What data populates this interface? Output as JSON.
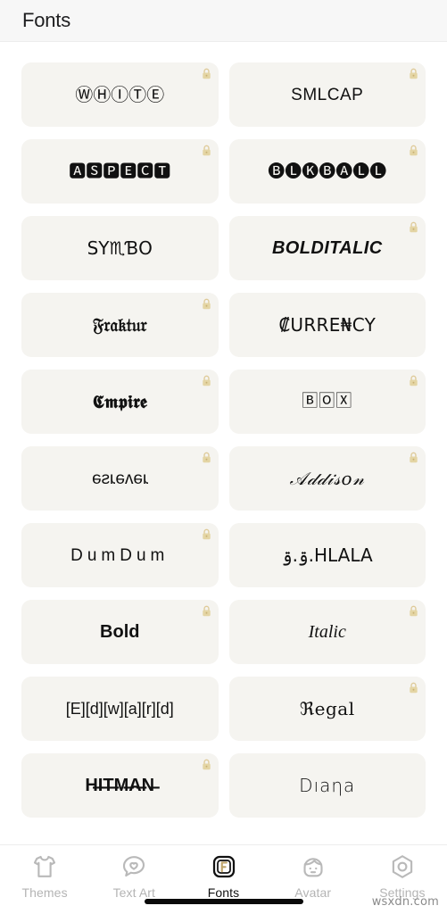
{
  "header": {
    "title": "Fonts"
  },
  "theme": {
    "page_bg": "#ffffff",
    "header_bg": "#f7f7f7",
    "card_bg": "#f5f4f0",
    "text": "#111111",
    "lock_color": "#e3d3a0",
    "tab_inactive": "#b4b4b4",
    "tab_active": "#111111",
    "accent": "#c9b075"
  },
  "fonts_grid": {
    "cards": [
      {
        "id": "white",
        "sample": "ⓌⒽⒾⓉⒺ",
        "style": "s-circled",
        "locked": true
      },
      {
        "id": "smlcap",
        "sample": "SMLCAP",
        "style": "s-plain",
        "locked": true
      },
      {
        "id": "aspect",
        "sample": "🅰🆂🅿🅴🅲🆃",
        "style": "s-blocky",
        "locked": true
      },
      {
        "id": "blkball",
        "sample": "🅑🅛🅚🅑🅐🅛🅛",
        "style": "s-blocky",
        "locked": true
      },
      {
        "id": "symbo",
        "sample": "SY♏ƁO",
        "style": "s-symbol",
        "locked": false
      },
      {
        "id": "bolditalic",
        "sample": "BOLDITALIC",
        "style": "s-bolditalic",
        "locked": true
      },
      {
        "id": "fraktur",
        "sample": "𝔉𝔯𝔞𝔨𝔱𝔲𝔯",
        "style": "s-fraktur",
        "locked": true
      },
      {
        "id": "currency",
        "sample": "₡URRE₦CY",
        "style": "s-currency",
        "locked": false
      },
      {
        "id": "empire",
        "sample": "𝕮𝖒𝖕𝖎𝖗𝖊",
        "style": "s-fraktur",
        "locked": true
      },
      {
        "id": "box",
        "sample": "🄱🄾🅇",
        "style": "s-boxed",
        "locked": true
      },
      {
        "id": "reverse",
        "sample": "ɹǝʌǝɹsǝ",
        "style": "s-reverse",
        "locked": true
      },
      {
        "id": "addison",
        "sample": "𝒜𝒹𝒹𝒾𝓈𝑜𝓃",
        "style": "s-script",
        "locked": true
      },
      {
        "id": "dumdum",
        "sample": "DumDum",
        "style": "s-spaced",
        "locked": true
      },
      {
        "id": "hlala",
        "sample": "ۊ.ۊ.HLALA",
        "style": "s-arabic",
        "locked": false
      },
      {
        "id": "bold",
        "sample": "Bold",
        "style": "s-bold",
        "locked": true
      },
      {
        "id": "italic",
        "sample": "Italic",
        "style": "s-italic",
        "locked": true
      },
      {
        "id": "edward",
        "sample": "[E][d][w][a][r][d]",
        "style": "s-bracket",
        "locked": false
      },
      {
        "id": "regal",
        "sample": "ℜegal",
        "style": "s-regal",
        "locked": true
      },
      {
        "id": "hitman",
        "sample": "H̶I̶T̶M̶A̶N̶",
        "style": "s-strike",
        "locked": true
      },
      {
        "id": "diana",
        "sample": "Dıaηa",
        "style": "s-diana",
        "locked": false
      }
    ]
  },
  "tabbar": {
    "items": [
      {
        "id": "themes",
        "label": "Themes",
        "icon": "tshirt-icon",
        "active": false
      },
      {
        "id": "textart",
        "label": "Text Art",
        "icon": "speech-heart-icon",
        "active": false
      },
      {
        "id": "fonts",
        "label": "Fonts",
        "icon": "font-f-icon",
        "active": true
      },
      {
        "id": "avatar",
        "label": "Avatar",
        "icon": "face-icon",
        "active": false
      },
      {
        "id": "settings",
        "label": "Settings",
        "icon": "hex-gear-icon",
        "active": false
      }
    ]
  },
  "watermark": {
    "text": "wsxdn.com"
  }
}
